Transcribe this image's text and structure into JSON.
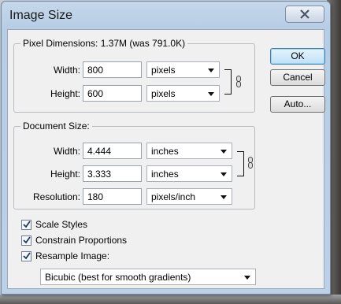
{
  "dialog": {
    "title": "Image Size",
    "close_glyph": "X"
  },
  "pixel_dimensions": {
    "legend": "Pixel Dimensions:  1.37M (was 791.0K)",
    "width_label": "Width:",
    "width_value": "800",
    "width_unit": "pixels",
    "height_label": "Height:",
    "height_value": "600",
    "height_unit": "pixels"
  },
  "document_size": {
    "legend": "Document Size:",
    "width_label": "Width:",
    "width_value": "4.444",
    "width_unit": "inches",
    "height_label": "Height:",
    "height_value": "3.333",
    "height_unit": "inches",
    "resolution_label": "Resolution:",
    "resolution_value": "180",
    "resolution_unit": "pixels/inch"
  },
  "buttons": {
    "ok": "OK",
    "cancel": "Cancel",
    "auto": "Auto..."
  },
  "options": {
    "scale_styles": "Scale Styles",
    "constrain_proportions": "Constrain Proportions",
    "resample_image": "Resample Image:",
    "resample_method": "Bicubic (best for smooth gradients)"
  }
}
